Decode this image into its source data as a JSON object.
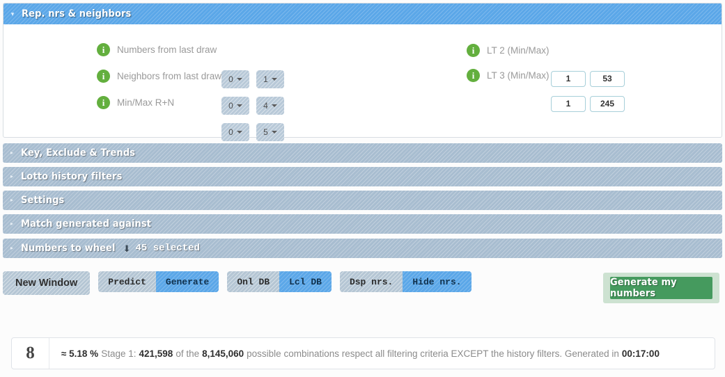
{
  "open_panel": {
    "title": "Rep. nrs & neighbors",
    "caret": "▾",
    "left_options": [
      {
        "label": "Numbers from last draw",
        "min": "0",
        "max": "1",
        "info": "i"
      },
      {
        "label": "Neighbors from last draw",
        "min": "0",
        "max": "4",
        "info": "i"
      },
      {
        "label": "Min/Max R+N",
        "min": "0",
        "max": "5",
        "info": "i"
      }
    ],
    "right_options": [
      {
        "label": "LT 2 (Min/Max)",
        "min": "1",
        "max": "53",
        "info": "i"
      },
      {
        "label": "LT 3 (Min/Max)",
        "min": "1",
        "max": "245",
        "info": "i"
      }
    ]
  },
  "collapsed_sections": [
    {
      "title": "Key, Exclude & Trends",
      "caret": "▸"
    },
    {
      "title": "Lotto history filters",
      "caret": "▸"
    },
    {
      "title": "Settings",
      "caret": "▸"
    },
    {
      "title": "Match generated against",
      "caret": "▸"
    },
    {
      "title": "Numbers to wheel",
      "caret": "▸",
      "wheel_icon": "⬇",
      "count": "45 selected"
    }
  ],
  "toolbar": {
    "new_window": "New Window",
    "groups": [
      {
        "buttons": [
          {
            "label": "Predict",
            "active": false
          },
          {
            "label": "Generate",
            "active": true
          }
        ]
      },
      {
        "buttons": [
          {
            "label": "Onl DB",
            "active": false
          },
          {
            "label": "Lcl DB",
            "active": true
          }
        ]
      },
      {
        "buttons": [
          {
            "label": "Dsp nrs.",
            "active": false
          },
          {
            "label": "Hide nrs.",
            "active": true
          }
        ]
      }
    ],
    "generate_my_numbers": "Generate my numbers"
  },
  "status": {
    "glyph": "8",
    "percent": "≈ 5.18 %",
    "stage_label": "Stage 1:",
    "matched": "421,598",
    "of_the": "of the",
    "total": "8,145,060",
    "middle_text": "possible combinations respect all filtering criteria EXCEPT the history filters. Generated in",
    "elapsed": "00:17:00"
  },
  "colors": {
    "accent_blue": "#5ba7e8",
    "panel_grey": "#a8bdd0",
    "green": "#459a5e",
    "info_green": "#63af3e"
  }
}
